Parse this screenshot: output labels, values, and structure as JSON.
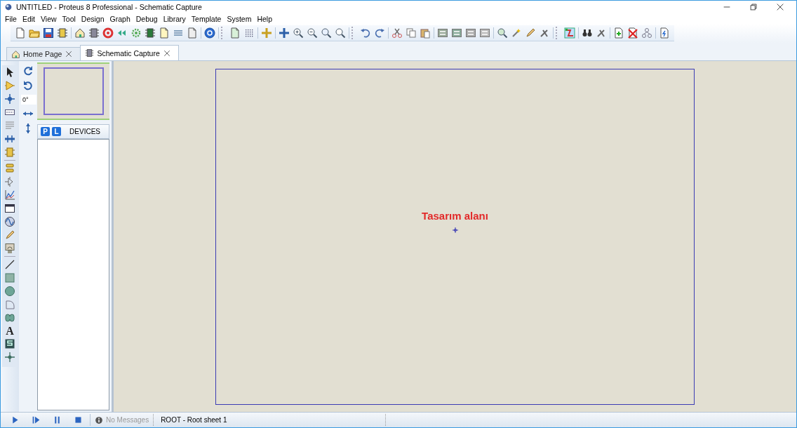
{
  "window": {
    "title": "UNTITLED - Proteus 8 Professional - Schematic Capture"
  },
  "menu": [
    "File",
    "Edit",
    "View",
    "Tool",
    "Design",
    "Graph",
    "Debug",
    "Library",
    "Template",
    "System",
    "Help"
  ],
  "tabs": [
    {
      "label": "Home Page",
      "selected": false
    },
    {
      "label": "Schematic Capture",
      "selected": true
    }
  ],
  "toolbox": {
    "text_tool_glyph": "A"
  },
  "orientation": {
    "angle": "0°"
  },
  "device_selector": {
    "buttons": [
      "P",
      "L"
    ],
    "title": "DEVICES"
  },
  "canvas": {
    "annotation": "Tasarım alanı"
  },
  "status_bar": {
    "messages": "No Messages",
    "sheet": "ROOT - Root sheet 1"
  }
}
